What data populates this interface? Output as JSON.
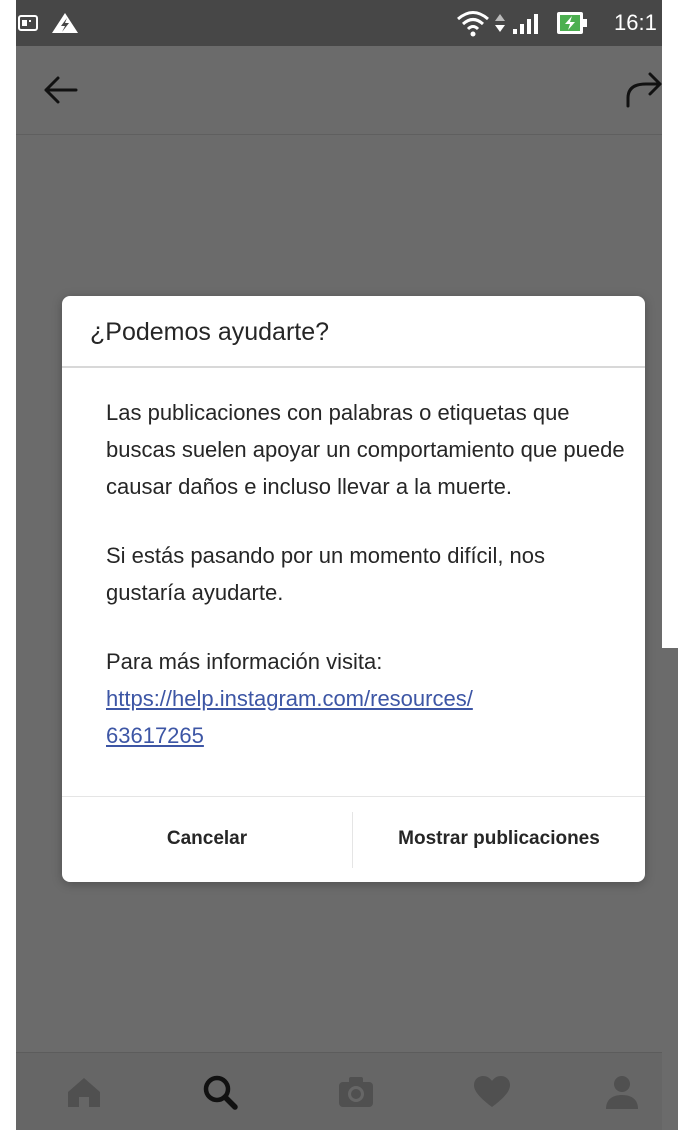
{
  "status_bar": {
    "time": "16:1",
    "icons": [
      "sd-card-icon",
      "alert-icon",
      "wifi-icon",
      "data-arrows-icon",
      "signal-icon",
      "battery-charging-icon"
    ]
  },
  "top_bar": {
    "icons": [
      "back-arrow-icon",
      "share-arrow-icon"
    ]
  },
  "dialog": {
    "title": "¿Podemos ayudarte?",
    "paragraph1": "Las publicaciones con palabras o etiquetas que buscas suelen apoyar un comportamiento que puede causar daños e incluso llevar a la muerte.",
    "paragraph2": "Si estás pasando por un momento difícil, nos gustaría ayudarte.",
    "paragraph3_prefix": "Para más información visita:",
    "link": "https://help.instagram.com/resources/63617265",
    "link_line1": "https://help.instagram.com/resources/",
    "link_line2": "63617265",
    "cancel_label": "Cancelar",
    "show_label": "Mostrar publicaciones",
    "link_color": "#3d56a5"
  },
  "bottom_nav": {
    "items": [
      "home-icon",
      "search-icon",
      "camera-icon",
      "heart-icon",
      "profile-icon"
    ],
    "active": "search-icon"
  }
}
